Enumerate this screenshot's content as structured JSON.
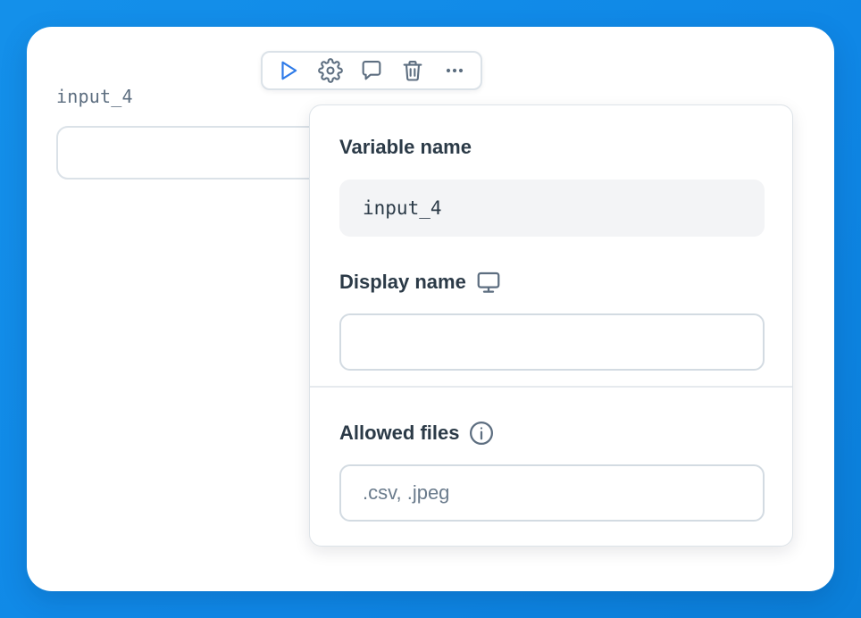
{
  "cell": {
    "label": "input_4",
    "input_value": ""
  },
  "toolbar": {
    "buttons": [
      {
        "name": "run",
        "icon": "play-icon",
        "color": "#2f7be8"
      },
      {
        "name": "settings",
        "icon": "gear-icon",
        "color": "#5d6e80"
      },
      {
        "name": "comment",
        "icon": "comment-icon",
        "color": "#5d6e80"
      },
      {
        "name": "delete",
        "icon": "trash-icon",
        "color": "#5d6e80"
      },
      {
        "name": "more",
        "icon": "more-horizontal-icon",
        "color": "#5d6e80"
      }
    ]
  },
  "popover": {
    "variable_name": {
      "label": "Variable name",
      "value": "input_4"
    },
    "display_name": {
      "label": "Display name",
      "icon": "monitor-icon",
      "value": "",
      "placeholder": ""
    },
    "allowed_files": {
      "label": "Allowed files",
      "icon": "info-icon",
      "value": "",
      "placeholder": ".csv, .jpeg"
    }
  },
  "colors": {
    "background": "#1490ea",
    "accent": "#2f7be8",
    "text": "#2b3a47",
    "muted": "#5d6e80"
  }
}
